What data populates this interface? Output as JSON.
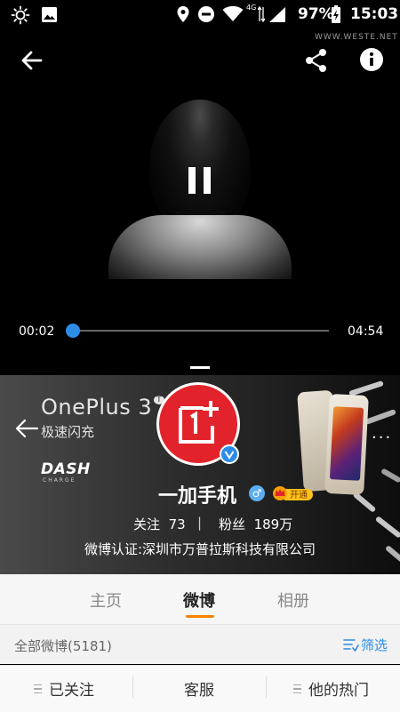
{
  "status_bar": {
    "battery": "97%",
    "time": "15:03",
    "network": "4G",
    "watermark": "WWW.WESTE.NET"
  },
  "video": {
    "current_time": "00:02",
    "duration": "04:54",
    "progress": 0.007
  },
  "banner": {
    "ad_title": "OnePlus 3",
    "ad_title_sup": "T",
    "ad_subtitle": "极速闪充",
    "ad_logo": "DASH",
    "ad_logo_sub": "CHARGE",
    "username": "一加手机",
    "vip_badge": "开通",
    "following_label": "关注",
    "following_count": "73",
    "followers_label": "粉丝",
    "followers_count": "189万",
    "certification": "微博认证:深圳市万普拉斯科技有限公司"
  },
  "tabs": {
    "home": "主页",
    "weibo": "微博",
    "album": "相册",
    "active": "微博"
  },
  "filter_bar": {
    "all_posts": "全部微博(5181)",
    "filter": "筛选"
  },
  "bottom_bar": {
    "followed": "已关注",
    "service": "客服",
    "hot": "他的热门"
  },
  "colors": {
    "accent_blue": "#2d8ce6",
    "tab_indicator": "#ff8200",
    "brand_red": "#e2232b"
  }
}
